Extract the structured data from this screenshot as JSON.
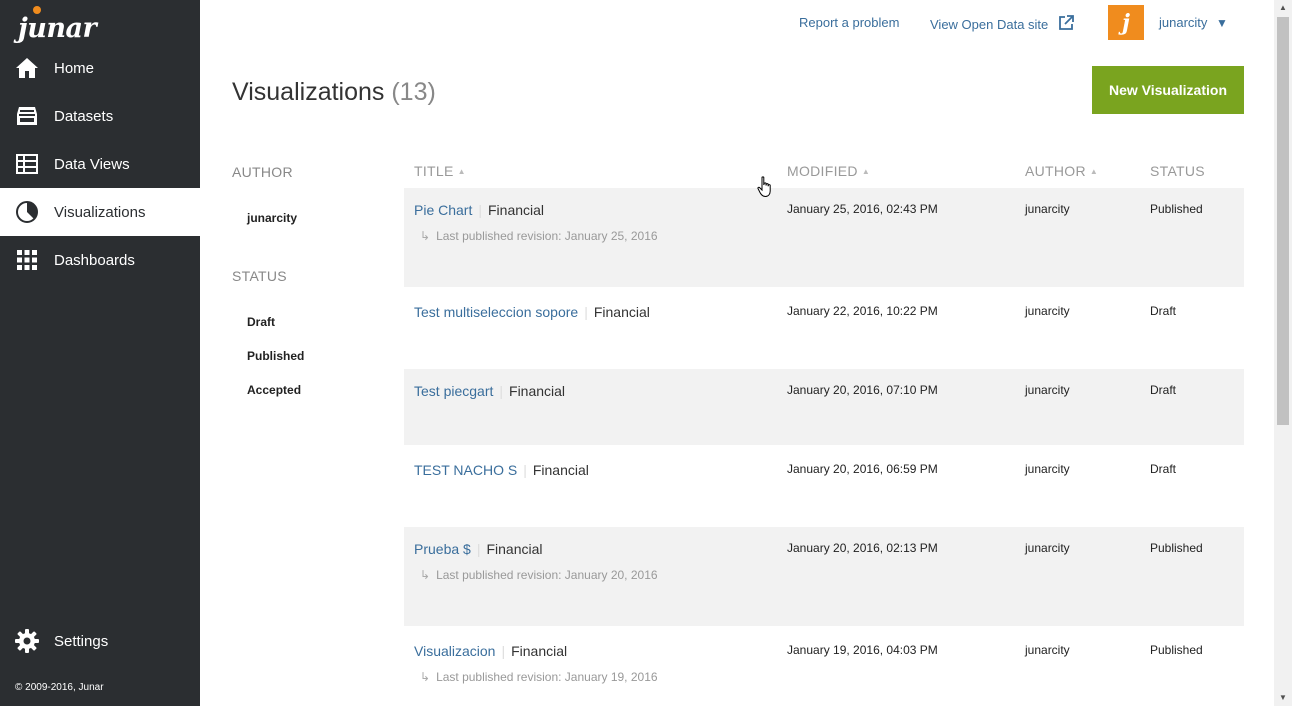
{
  "brand": {
    "logo_text": "junar"
  },
  "sidebar": {
    "items": [
      {
        "label": "Home",
        "icon": "home-icon"
      },
      {
        "label": "Datasets",
        "icon": "datasets-icon"
      },
      {
        "label": "Data Views",
        "icon": "data-views-icon"
      },
      {
        "label": "Visualizations",
        "icon": "visualizations-icon",
        "active": true
      },
      {
        "label": "Dashboards",
        "icon": "dashboards-icon"
      }
    ],
    "settings_label": "Settings",
    "copyright": "© 2009-2016, Junar"
  },
  "topbar": {
    "report_problem": "Report a problem",
    "view_open_data": "View Open Data site",
    "username": "junarcity",
    "username_caret": "▼"
  },
  "page": {
    "title": "Visualizations",
    "count": "(13)",
    "new_button": "New Visualization"
  },
  "filters": {
    "author_heading": "AUTHOR",
    "authors": [
      "junarcity"
    ],
    "status_heading": "STATUS",
    "statuses": [
      "Draft",
      "Published",
      "Accepted"
    ]
  },
  "table": {
    "columns": {
      "title": "TITLE",
      "modified": "MODIFIED",
      "author": "AUTHOR",
      "status": "STATUS"
    },
    "rows": [
      {
        "title": "Pie Chart",
        "category": "Financial",
        "modified": "January 25, 2016, 02:43 PM",
        "author": "junarcity",
        "status": "Published",
        "revision": "Last published revision: January 25, 2016"
      },
      {
        "title": "Test multiseleccion sopore",
        "category": "Financial",
        "modified": "January 22, 2016, 10:22 PM",
        "author": "junarcity",
        "status": "Draft",
        "revision": ""
      },
      {
        "title": "Test piecgart",
        "category": "Financial",
        "modified": "January 20, 2016, 07:10 PM",
        "author": "junarcity",
        "status": "Draft",
        "revision": ""
      },
      {
        "title": "TEST NACHO S",
        "category": "Financial",
        "modified": "January 20, 2016, 06:59 PM",
        "author": "junarcity",
        "status": "Draft",
        "revision": ""
      },
      {
        "title": "Prueba $",
        "category": "Financial",
        "modified": "January 20, 2016, 02:13 PM",
        "author": "junarcity",
        "status": "Published",
        "revision": "Last published revision: January 20, 2016"
      },
      {
        "title": "Visualizacion",
        "category": "Financial",
        "modified": "January 19, 2016, 04:03 PM",
        "author": "junarcity",
        "status": "Published",
        "revision": "Last published revision: January 19, 2016"
      }
    ]
  },
  "colors": {
    "sidebar_bg": "#2b2e31",
    "accent_green": "#7aa41f",
    "brand_orange": "#f08c1e",
    "link_blue": "#3a6e9c"
  }
}
